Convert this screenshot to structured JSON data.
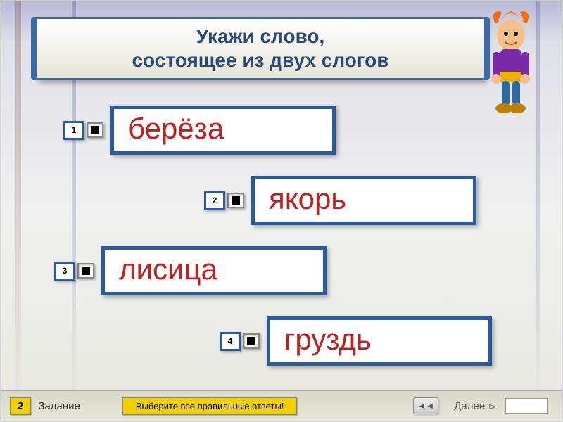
{
  "title": {
    "line1": "Укажи слово,",
    "line2": "состоящее из двух слогов"
  },
  "options": [
    {
      "num": "1",
      "word": "берёза"
    },
    {
      "num": "2",
      "word": "якорь"
    },
    {
      "num": "3",
      "word": "лисица"
    },
    {
      "num": "4",
      "word": "груздь"
    }
  ],
  "footer": {
    "task_num": "2",
    "task_label": "Задание",
    "instruction": "Выберите все правильные ответы!",
    "next_label": "Далее",
    "rewind_glyph": "◄◄"
  }
}
